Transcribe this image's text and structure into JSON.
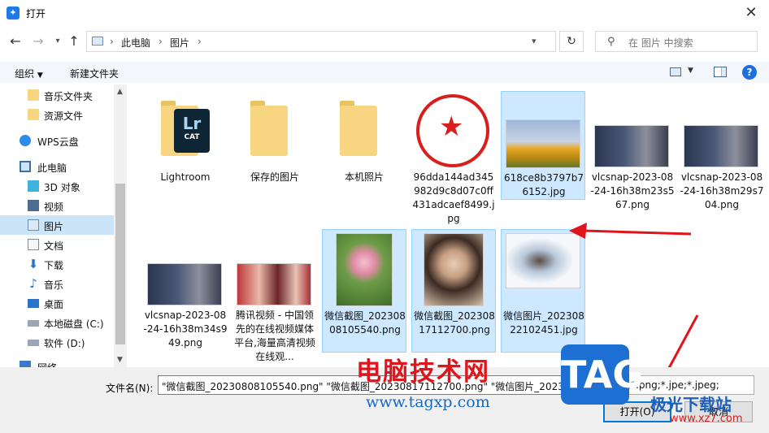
{
  "window": {
    "title": "打开"
  },
  "address": {
    "crumbs": [
      "此电脑",
      "图片"
    ]
  },
  "search": {
    "placeholder": "在 图片 中搜索"
  },
  "toolbar": {
    "organize": "组织",
    "new_folder": "新建文件夹",
    "cancel_label": "取消",
    "open_label": "打开(O)"
  },
  "sidebar": {
    "items": [
      {
        "label": "音乐文件夹",
        "icon": "folder-icon"
      },
      {
        "label": "资源文件",
        "icon": "folder-icon"
      },
      {
        "label": "WPS云盘",
        "icon": "cloud-icon"
      },
      {
        "label": "此电脑",
        "icon": "computer-icon"
      },
      {
        "label": "3D 对象",
        "icon": "cube-icon"
      },
      {
        "label": "视频",
        "icon": "video-icon"
      },
      {
        "label": "图片",
        "icon": "pictures-icon"
      },
      {
        "label": "文档",
        "icon": "document-icon"
      },
      {
        "label": "下载",
        "icon": "download-icon"
      },
      {
        "label": "音乐",
        "icon": "music-icon"
      },
      {
        "label": "桌面",
        "icon": "desktop-icon"
      },
      {
        "label": "本地磁盘 (C:)",
        "icon": "drive-icon"
      },
      {
        "label": "软件 (D:)",
        "icon": "drive-icon"
      },
      {
        "label": "网络",
        "icon": "network-icon"
      }
    ]
  },
  "files": [
    {
      "name": "Lightroom",
      "kind": "folder"
    },
    {
      "name": "保存的图片",
      "kind": "folder"
    },
    {
      "name": "本机照片",
      "kind": "folder"
    },
    {
      "name": "96dda144ad345982d9c8d07c0ff431adcaef8499.jpg",
      "kind": "image"
    },
    {
      "name": "618ce8b3797b76152.jpg",
      "kind": "image"
    },
    {
      "name": "vlcsnap-2023-08-24-16h38m23s567.png",
      "kind": "image"
    },
    {
      "name": "vlcsnap-2023-08-24-16h38m29s704.png",
      "kind": "image"
    },
    {
      "name": "vlcsnap-2023-08-24-16h38m34s949.png",
      "kind": "image"
    },
    {
      "name": "腾讯视频 - 中国领先的在线视频媒体平台,海量高清视频在线观...",
      "kind": "image"
    },
    {
      "name": "微信截图_20230808105540.png",
      "kind": "image"
    },
    {
      "name": "微信截图_20230817112700.png",
      "kind": "image"
    },
    {
      "name": "微信图片_20230822102451.jpg",
      "kind": "image"
    }
  ],
  "folder_badge": {
    "top": "Lr",
    "bottom": "CAT"
  },
  "bottom": {
    "filename_label": "文件名(N):",
    "filename_value": "\"微信截图_20230808105540.png\" \"微信截图_20230817112700.png\" \"微信图片_20230822102451.jpg\"",
    "filter_value": "(*.jpg;*.png;*.jpe;*.jpeg;"
  },
  "watermark": {
    "site_cn": "电脑技术网",
    "site_url": "www.tagxp.com",
    "tag": "TAG",
    "brand": "极光下载站",
    "brand_url": "www.xz7.com"
  },
  "colors": {
    "accent": "#0078d7",
    "selection": "#cde8ff",
    "arrow": "#e0141b"
  }
}
